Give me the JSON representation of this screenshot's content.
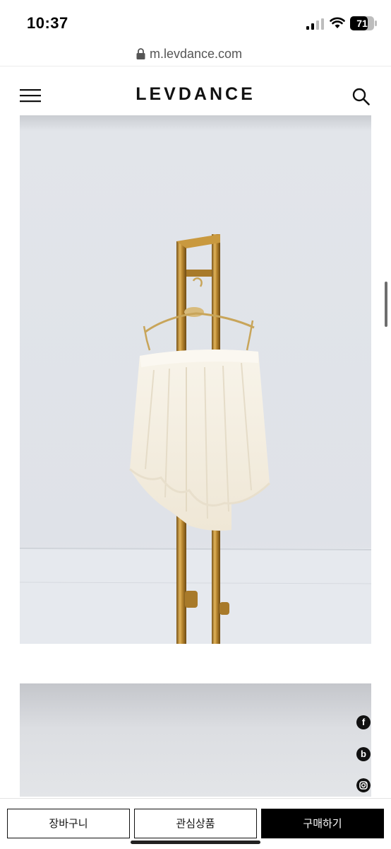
{
  "status_bar": {
    "time": "10:37",
    "battery_level": "71",
    "icons": [
      "signal-icon",
      "wifi-icon",
      "battery-icon"
    ]
  },
  "url_bar": {
    "url": "m.levdance.com",
    "icon": "lock-icon"
  },
  "header": {
    "brand": "LEVDANCE",
    "icons": [
      "menu-icon",
      "search-icon"
    ]
  },
  "images": [
    {
      "subject": "white lace tutu skirt on gold hanger stand"
    },
    {
      "subject": "grey backdrop"
    }
  ],
  "social": {
    "icons": [
      "facebook-icon",
      "blog-icon",
      "instagram-icon"
    ],
    "labels": {
      "facebook": "f",
      "blog": "b"
    }
  },
  "bottom_bar": {
    "cart_label": "장바구니",
    "wishlist_label": "관심상품",
    "buy_label": "구매하기"
  },
  "colors": {
    "buy_button": "#000000",
    "gold_stand": "#b8862f",
    "backdrop": "#e4e7ed"
  }
}
